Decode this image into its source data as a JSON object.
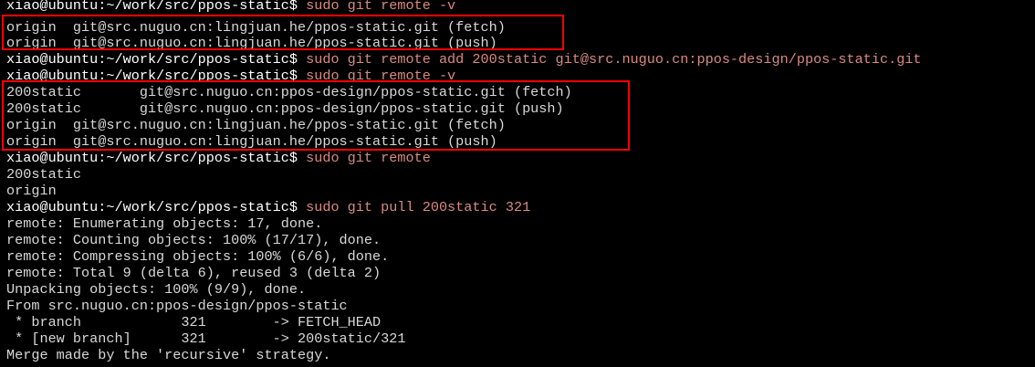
{
  "terminal": {
    "highlight_color": "#ff0000",
    "prompt": "xiao@ubuntu:~/work/src/ppos-static$",
    "lines": [
      {
        "prompt": "xiao@ubuntu:~/work/src/ppos-static$",
        "cmd": " sudo git remote -v"
      },
      {
        "text": "origin  git@src.nuguo.cn:lingjuan.he/ppos-static.git (fetch)"
      },
      {
        "text": "origin  git@src.nuguo.cn:lingjuan.he/ppos-static.git (push)"
      },
      {
        "prompt": "xiao@ubuntu:~/work/src/ppos-static$",
        "cmd": " sudo git remote add 200static git@src.nuguo.cn:ppos-design/ppos-static.git"
      },
      {
        "prompt": "xiao@ubuntu:~/work/src/ppos-static$",
        "cmd": " sudo git remote -v"
      },
      {
        "text": "200static       git@src.nuguo.cn:ppos-design/ppos-static.git (fetch)"
      },
      {
        "text": "200static       git@src.nuguo.cn:ppos-design/ppos-static.git (push)"
      },
      {
        "text": "origin  git@src.nuguo.cn:lingjuan.he/ppos-static.git (fetch)"
      },
      {
        "text": "origin  git@src.nuguo.cn:lingjuan.he/ppos-static.git (push)"
      },
      {
        "prompt": "xiao@ubuntu:~/work/src/ppos-static$",
        "cmd": " sudo git remote"
      },
      {
        "text": "200static"
      },
      {
        "text": "origin"
      },
      {
        "prompt": "xiao@ubuntu:~/work/src/ppos-static$",
        "cmd": " sudo git pull 200static 321"
      },
      {
        "text": "remote: Enumerating objects: 17, done."
      },
      {
        "text": "remote: Counting objects: 100% (17/17), done."
      },
      {
        "text": "remote: Compressing objects: 100% (6/6), done."
      },
      {
        "text": "remote: Total 9 (delta 6), reused 3 (delta 2)"
      },
      {
        "text": "Unpacking objects: 100% (9/9), done."
      },
      {
        "text": "From src.nuguo.cn:ppos-design/ppos-static"
      },
      {
        "text": " * branch            321        -> FETCH_HEAD"
      },
      {
        "text": " * [new branch]      321        -> 200static/321"
      },
      {
        "text": "Merge made by the 'recursive' strategy."
      }
    ]
  }
}
